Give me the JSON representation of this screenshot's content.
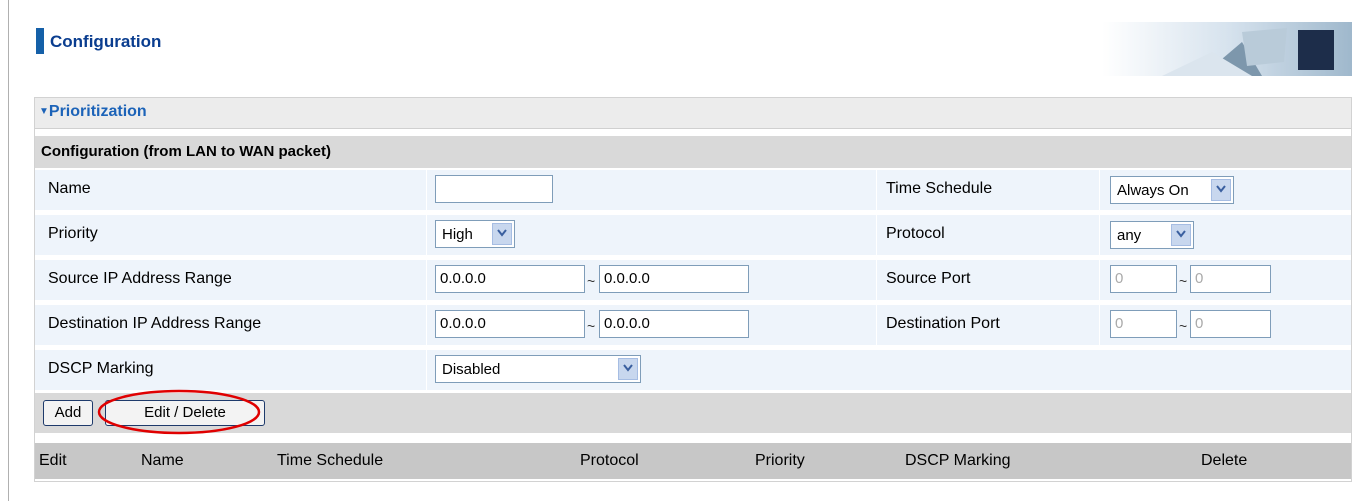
{
  "header": {
    "title": "Configuration"
  },
  "section": {
    "title": "Prioritization"
  },
  "config": {
    "heading": "Configuration (from LAN to WAN packet)"
  },
  "fields": {
    "name": {
      "label": "Name",
      "value": ""
    },
    "time_schedule": {
      "label": "Time Schedule",
      "value": "Always On"
    },
    "priority": {
      "label": "Priority",
      "value": "High"
    },
    "protocol": {
      "label": "Protocol",
      "value": "any"
    },
    "src_ip": {
      "label": "Source IP Address Range",
      "from": "0.0.0.0",
      "to": "0.0.0.0"
    },
    "src_port": {
      "label": "Source Port",
      "from": "0",
      "to": "0"
    },
    "dst_ip": {
      "label": "Destination IP Address Range",
      "from": "0.0.0.0",
      "to": "0.0.0.0"
    },
    "dst_port": {
      "label": "Destination Port",
      "from": "0",
      "to": "0"
    },
    "dscp": {
      "label": "DSCP Marking",
      "value": "Disabled"
    },
    "range_separator": "~"
  },
  "buttons": {
    "add": "Add",
    "edit_delete": "Edit / Delete"
  },
  "table": {
    "columns": [
      "Edit",
      "Name",
      "Time Schedule",
      "Protocol",
      "Priority",
      "DSCP Marking",
      "Delete"
    ]
  },
  "colors": {
    "accent": "#1560a8",
    "row_bg": "#eef4fb",
    "highlight_circle": "#e00000"
  }
}
